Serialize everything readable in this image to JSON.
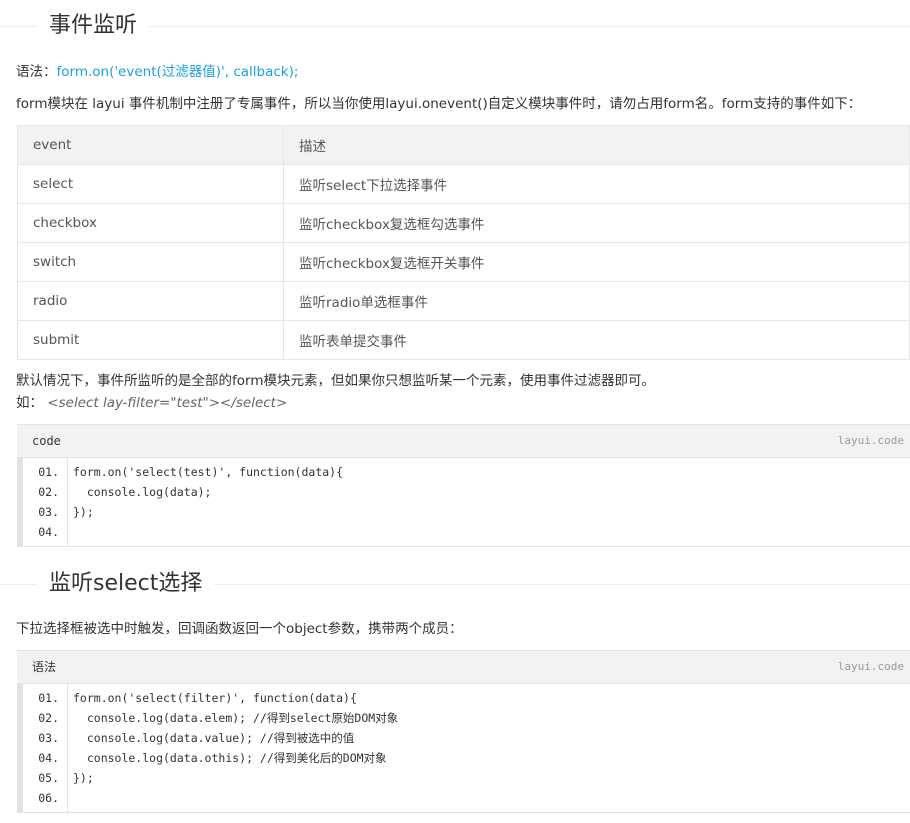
{
  "section1": {
    "title": "事件监听"
  },
  "syntax": {
    "label": "语法：",
    "code": "form.on('event(过滤器值)', callback);"
  },
  "intro": "form模块在 layui 事件机制中注册了专属事件，所以当你使用layui.onevent()自定义模块事件时，请勿占用form名。form支持的事件如下：",
  "events_table": {
    "headers": [
      "event",
      "描述"
    ],
    "rows": [
      [
        "select",
        "监听select下拉选择事件"
      ],
      [
        "checkbox",
        "监听checkbox复选框勾选事件"
      ],
      [
        "switch",
        "监听checkbox复选框开关事件"
      ],
      [
        "radio",
        "监听radio单选框事件"
      ],
      [
        "submit",
        "监听表单提交事件"
      ]
    ]
  },
  "note1": "默认情况下，事件所监听的是全部的form模块元素，但如果你只想监听某一个元素，使用事件过滤器即可。",
  "note2": {
    "prefix": "如：",
    "example": "<select lay-filter=\"test\"></select>"
  },
  "code1": {
    "title": "code",
    "tag": "layui.code",
    "lines": [
      {
        "num": "01.",
        "text": "form.on('select(test)', function(data){"
      },
      {
        "num": "02.",
        "text": "  console.log(data);"
      },
      {
        "num": "03.",
        "text": "});"
      },
      {
        "num": "04.",
        "text": ""
      }
    ]
  },
  "section2": {
    "title": "监听select选择"
  },
  "desc2": "下拉选择框被选中时触发，回调函数返回一个object参数，携带两个成员：",
  "code2": {
    "title": "语法",
    "tag": "layui.code",
    "lines": [
      {
        "num": "01.",
        "text": "form.on('select(filter)', function(data){"
      },
      {
        "num": "02.",
        "text": "  console.log(data.elem); //得到select原始DOM对象"
      },
      {
        "num": "03.",
        "text": "  console.log(data.value); //得到被选中的值"
      },
      {
        "num": "04.",
        "text": "  console.log(data.othis); //得到美化后的DOM对象"
      },
      {
        "num": "05.",
        "text": "});"
      },
      {
        "num": "06.",
        "text": ""
      }
    ]
  },
  "colors": {
    "accent": "#1aa1e0",
    "header_bg": "#f2f2f2",
    "border": "#e2e2e2"
  }
}
